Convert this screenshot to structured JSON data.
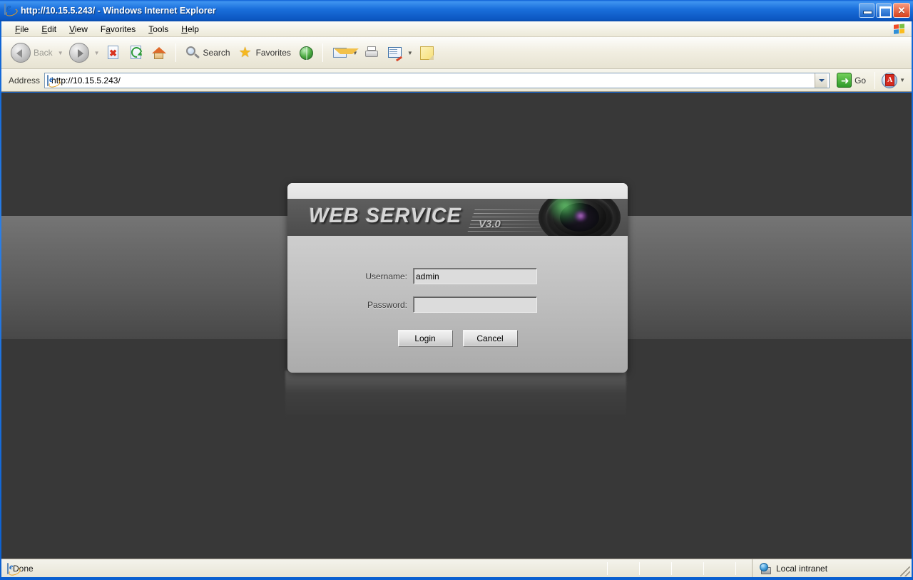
{
  "window": {
    "title": "http://10.15.5.243/ - Windows Internet Explorer",
    "icons": {
      "app": "ie-icon",
      "minimize": "minimize-icon",
      "maximize": "restore-icon",
      "close": "close-icon"
    }
  },
  "menu": {
    "items": [
      {
        "label": "File",
        "accel": "F"
      },
      {
        "label": "Edit",
        "accel": "E"
      },
      {
        "label": "View",
        "accel": "V"
      },
      {
        "label": "Favorites",
        "accel": "a"
      },
      {
        "label": "Tools",
        "accel": "T"
      },
      {
        "label": "Help",
        "accel": "H"
      }
    ],
    "logo_icon": "windows-flag-icon"
  },
  "toolbar": {
    "back_label": "Back",
    "forward_label": "",
    "search_label": "Search",
    "favorites_label": "Favorites",
    "icons": {
      "back": "back-arrow-icon",
      "forward": "forward-arrow-icon",
      "stop": "stop-icon",
      "refresh": "refresh-icon",
      "home": "home-icon",
      "search": "search-icon",
      "favorites": "star-icon",
      "media": "globe-icon",
      "mail": "mail-icon",
      "print": "printer-icon",
      "edit": "edit-icon",
      "note": "note-icon"
    }
  },
  "address": {
    "label": "Address",
    "value": "http://10.15.5.243/",
    "placeholder": "",
    "go_label": "Go",
    "icons": {
      "page": "ie-icon",
      "dropdown": "chevron-down-icon",
      "go": "go-arrow-icon",
      "pdf": "pdf-icon",
      "pdf_dropdown": "chevron-down-icon"
    }
  },
  "login": {
    "brand_title": "WEB  SERVICE",
    "brand_version": "V3.0",
    "camera_icon": "camera-lens-icon",
    "username_label": "Username:",
    "username_value": "admin",
    "username_placeholder": "",
    "password_label": "Password:",
    "password_value": "",
    "password_placeholder": "",
    "login_label": "Login",
    "cancel_label": "Cancel"
  },
  "statusbar": {
    "status_text": "Done",
    "status_icon": "ie-icon",
    "zone_text": "Local intranet",
    "zone_icon": "local-intranet-icon",
    "grip_icon": "resize-grip-icon"
  },
  "colors": {
    "titlebar_blue": "#1a6fdc",
    "chrome_beige": "#ece9d8",
    "page_dark": "#383838",
    "page_band": "#757575",
    "dialog_body": "#cfcfcf",
    "dialog_header": "#565656",
    "go_green": "#2f9a2a"
  }
}
